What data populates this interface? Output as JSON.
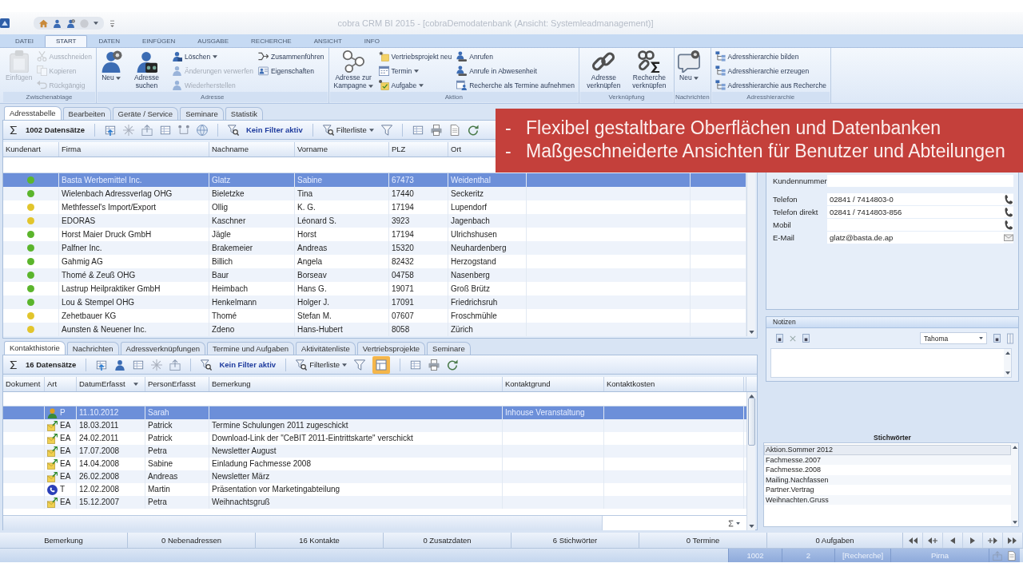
{
  "window": {
    "title": "cobra CRM BI 2015 - [cobraDemodatenbank (Ansicht: Systemleadmanagement)]"
  },
  "ribbon_tabs": [
    {
      "label": "DATEI",
      "selected": false
    },
    {
      "label": "START",
      "selected": true
    },
    {
      "label": "DATEN",
      "selected": false
    },
    {
      "label": "EINFÜGEN",
      "selected": false
    },
    {
      "label": "AUSGABE",
      "selected": false
    },
    {
      "label": "RECHERCHE",
      "selected": false
    },
    {
      "label": "ANSICHT",
      "selected": false
    },
    {
      "label": "INFO",
      "selected": false
    }
  ],
  "ribbon_groups": [
    {
      "label": "Zwischenablage",
      "items": [
        {
          "kind": "large",
          "label": "Einfügen",
          "disabled": true,
          "dropdown": false
        },
        {
          "kind": "stack",
          "buttons": [
            {
              "label": "Ausschneiden",
              "disabled": true,
              "dropdown": false
            },
            {
              "label": "Kopieren",
              "disabled": true,
              "dropdown": false
            },
            {
              "label": "Rückgängig",
              "disabled": true,
              "dropdown": false
            }
          ]
        }
      ]
    },
    {
      "label": "Adresse",
      "items": [
        {
          "kind": "large",
          "label": "Neu",
          "disabled": false,
          "dropdown": true
        },
        {
          "kind": "large",
          "label": "Adresse suchen",
          "disabled": false,
          "dropdown": false
        },
        {
          "kind": "stack",
          "buttons": [
            {
              "label": "Löschen",
              "disabled": false,
              "dropdown": true
            },
            {
              "label": "Änderungen verwerfen",
              "disabled": true,
              "dropdown": false
            },
            {
              "label": "Wiederherstellen",
              "disabled": true,
              "dropdown": false
            }
          ]
        },
        {
          "kind": "stack",
          "buttons": [
            {
              "label": "Zusammenführen",
              "disabled": false,
              "dropdown": false
            },
            {
              "label": "Eigenschaften",
              "disabled": false,
              "dropdown": false
            }
          ]
        }
      ]
    },
    {
      "label": "Aktion",
      "items": [
        {
          "kind": "large",
          "label": "Adresse zur Kampagne",
          "disabled": false,
          "dropdown": true
        },
        {
          "kind": "stack",
          "buttons": [
            {
              "label": "Vertriebsprojekt neu",
              "disabled": false,
              "dropdown": false
            },
            {
              "label": "Termin",
              "disabled": false,
              "dropdown": true
            },
            {
              "label": "Aufgabe",
              "disabled": false,
              "dropdown": true
            }
          ]
        },
        {
          "kind": "stack",
          "buttons": [
            {
              "label": "Anrufen",
              "disabled": false,
              "dropdown": false
            },
            {
              "label": "Anrufe in Abwesenheit",
              "disabled": false,
              "dropdown": false
            },
            {
              "label": "Recherche als Termine aufnehmen",
              "disabled": false,
              "dropdown": false
            }
          ]
        }
      ]
    },
    {
      "label": "Verknüpfung",
      "items": [
        {
          "kind": "large",
          "label": "Adresse verknüpfen",
          "disabled": false,
          "dropdown": false
        },
        {
          "kind": "large",
          "label": "Recherche verknüpfen",
          "disabled": false,
          "dropdown": false
        }
      ]
    },
    {
      "label": "Nachrichten",
      "items": [
        {
          "kind": "large",
          "label": "Neu",
          "disabled": false,
          "dropdown": true
        }
      ]
    },
    {
      "label": "Adresshierarchie",
      "items": [
        {
          "kind": "stack",
          "buttons": [
            {
              "label": "Adresshierarchie bilden",
              "disabled": false,
              "dropdown": false
            },
            {
              "label": "Adresshierarchie erzeugen",
              "disabled": false,
              "dropdown": false
            },
            {
              "label": "Adresshierarchie aus Recherche",
              "disabled": false,
              "dropdown": false
            }
          ]
        }
      ]
    }
  ],
  "address_panel": {
    "tabs": [
      {
        "label": "Adresstabelle",
        "selected": true
      },
      {
        "label": "Bearbeiten",
        "selected": false
      },
      {
        "label": "Geräte / Service",
        "selected": false
      },
      {
        "label": "Seminare",
        "selected": false
      },
      {
        "label": "Statistik",
        "selected": false
      }
    ],
    "record_count": "1002 Datensätze",
    "filter_status": "Kein Filter aktiv",
    "filter_list": "Filterliste",
    "table": {
      "columns": [
        "Kundenart",
        "Firma",
        "Nachname",
        "Vorname",
        "PLZ",
        "Ort"
      ],
      "rows": [
        {
          "selected": true,
          "color": "#5bb52c",
          "company": "Basta Werbemittel Inc.",
          "last_name": "Glatz",
          "first_name": "Sabine",
          "zip": "67473",
          "city": "Weidenthal"
        },
        {
          "selected": false,
          "color": "#5bb52c",
          "company": "Wielenbach Adressverlag OHG",
          "last_name": "Bieletzke",
          "first_name": "Tina",
          "zip": "17440",
          "city": "Seckeritz"
        },
        {
          "selected": false,
          "color": "#e2c52c",
          "company": "Methfessel's Import/Export",
          "last_name": "Ollig",
          "first_name": "K. G.",
          "zip": "17194",
          "city": "Lupendorf"
        },
        {
          "selected": false,
          "color": "#e2c52c",
          "company": "EDORAS",
          "last_name": "Kaschner",
          "first_name": "Léonard S.",
          "zip": "3923",
          "city": "Jagenbach"
        },
        {
          "selected": false,
          "color": "#5bb52c",
          "company": "Horst Maier Druck GmbH",
          "last_name": "Jägle",
          "first_name": "Horst",
          "zip": "17194",
          "city": "Ulrichshusen"
        },
        {
          "selected": false,
          "color": "#5bb52c",
          "company": "Palfner Inc.",
          "last_name": "Brakemeier",
          "first_name": "Andreas",
          "zip": "15320",
          "city": "Neuhardenberg"
        },
        {
          "selected": false,
          "color": "#5bb52c",
          "company": "Gahmig AG",
          "last_name": "Billich",
          "first_name": "Angela",
          "zip": "82432",
          "city": "Herzogstand"
        },
        {
          "selected": false,
          "color": "#5bb52c",
          "company": "Thomé & Zeuß OHG",
          "last_name": "Baur",
          "first_name": "Borseav",
          "zip": "04758",
          "city": "Nasenberg"
        },
        {
          "selected": false,
          "color": "#5bb52c",
          "company": "Lastrup Heilpraktiker GmbH",
          "last_name": "Heimbach",
          "first_name": "Hans G.",
          "zip": "19071",
          "city": "Groß Brütz"
        },
        {
          "selected": false,
          "color": "#5bb52c",
          "company": "Lou & Stempel OHG",
          "last_name": "Henkelmann",
          "first_name": "Holger J.",
          "zip": "17091",
          "city": "Friedrichsruh"
        },
        {
          "selected": false,
          "color": "#e2c52c",
          "company": "Zehetbauer KG",
          "last_name": "Thomé",
          "first_name": "Stefan M.",
          "zip": "07607",
          "city": "Froschmühle"
        },
        {
          "selected": false,
          "color": "#e2c52c",
          "company": "Aunsten & Neuener Inc.",
          "last_name": "Zdeno",
          "first_name": "Hans-Hubert",
          "zip": "8058",
          "city": "Zürich"
        }
      ]
    }
  },
  "details": {
    "customer_fields": [
      {
        "label": "Kundennummer"
      }
    ],
    "contact_fields": [
      {
        "label": "Telefon",
        "kind": "phone",
        "value": "02841 / 7414803-0"
      },
      {
        "label": "Telefon direkt",
        "kind": "phone",
        "value": "02841 / 7414803-856"
      },
      {
        "label": "Mobil",
        "kind": "phone"
      },
      {
        "label": "E-Mail",
        "kind": "email",
        "value": "glatz@basta.de.ap"
      }
    ]
  },
  "notes": {
    "title": "Notizen",
    "font_dropdown": "Tahoma"
  },
  "keywords": {
    "title": "Stichwörter",
    "items": [
      {
        "label": "Aktion.Sommer 2012",
        "selected": true
      },
      {
        "label": "Fachmesse.2007",
        "selected": false
      },
      {
        "label": "Fachmesse.2008",
        "selected": false
      },
      {
        "label": "Mailing.Nachfassen",
        "selected": false
      },
      {
        "label": "Partner.Vertrag",
        "selected": false
      },
      {
        "label": "Weihnachten.Gruss",
        "selected": false
      }
    ]
  },
  "contact_panel": {
    "tabs": [
      {
        "label": "Kontakthistorie",
        "selected": true
      },
      {
        "label": "Nachrichten",
        "selected": false
      },
      {
        "label": "Adressverknüpfungen",
        "selected": false
      },
      {
        "label": "Termine und Aufgaben",
        "selected": false
      },
      {
        "label": "Aktivitätenliste",
        "selected": false
      },
      {
        "label": "Vertriebsprojekte",
        "selected": false
      },
      {
        "label": "Seminare",
        "selected": false
      }
    ],
    "record_count": "16 Datensätze",
    "filter_status": "Kein Filter aktiv",
    "filter_list": "Filterliste",
    "layout_button": {
      "on": true
    },
    "table": {
      "columns": [
        {
          "label": "Dokument",
          "sorted": false
        },
        {
          "label": "Art",
          "sorted": false
        },
        {
          "label": "DatumErfasst",
          "sorted": true
        },
        {
          "label": "PersonErfasst",
          "sorted": false
        },
        {
          "label": "Bemerkung",
          "sorted": false
        },
        {
          "label": "Kontaktgrund",
          "sorted": false
        },
        {
          "label": "Kontaktkosten",
          "sorted": false
        }
      ],
      "rows": [
        {
          "selected": true,
          "kind": "personal",
          "art": "P",
          "date": "11.10.2012",
          "person": "Sarah",
          "reason": "Inhouse Veranstaltung"
        },
        {
          "selected": false,
          "kind": "email",
          "art": "EA",
          "date": "18.03.2011",
          "person": "Patrick",
          "remark": "Termine Schulungen 2011 zugeschickt"
        },
        {
          "selected": false,
          "kind": "email",
          "art": "EA",
          "date": "24.02.2011",
          "person": "Patrick",
          "remark": "Download-Link der \"CeBIT 2011-Eintrittskarte\" verschickt"
        },
        {
          "selected": false,
          "kind": "email",
          "art": "EA",
          "date": "17.07.2008",
          "person": "Petra",
          "remark": "Newsletter August"
        },
        {
          "selected": false,
          "kind": "email",
          "art": "EA",
          "date": "14.04.2008",
          "person": "Sabine",
          "remark": "Einladung Fachmesse 2008"
        },
        {
          "selected": false,
          "kind": "email",
          "art": "EA",
          "date": "26.02.2008",
          "person": "Andreas",
          "remark": "Newsletter März"
        },
        {
          "selected": false,
          "kind": "phone",
          "art": "T",
          "date": "12.02.2008",
          "person": "Martin",
          "remark": "Präsentation vor Marketingabteilung"
        },
        {
          "selected": false,
          "kind": "email",
          "art": "EA",
          "date": "15.12.2007",
          "person": "Petra",
          "remark": "Weihnachtsgruß"
        }
      ]
    }
  },
  "status_bar": {
    "cells": [
      "Bemerkung",
      "0 Nebenadressen",
      "16 Kontakte",
      "0 Zusatzdaten",
      "6 Stichwörter",
      "0 Termine",
      "0 Aufgaben"
    ]
  },
  "info_bar": {
    "cells": [
      "1002",
      "2",
      "[Recherche]",
      "Pirna"
    ]
  },
  "banner": {
    "lines": [
      {
        "marker": "-",
        "text": "Flexibel gestaltbare Oberflächen und Datenbanken"
      },
      {
        "marker": "-",
        "text": "Maßgeschneiderte Ansichten für Benutzer und Abteilungen"
      }
    ]
  }
}
